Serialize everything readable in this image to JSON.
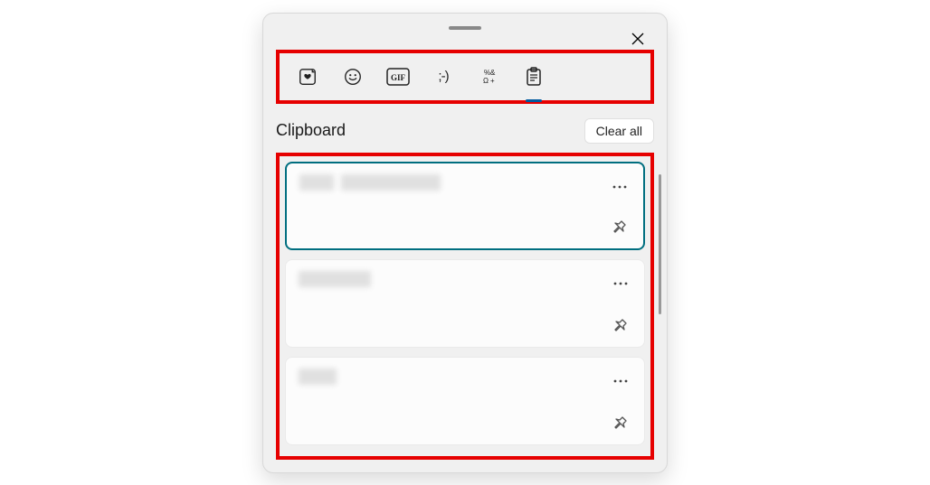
{
  "header": {
    "section_title": "Clipboard",
    "clear_all_label": "Clear all"
  },
  "toolbar": {
    "tabs": [
      {
        "name": "recent",
        "icon": "heart-sticker-icon"
      },
      {
        "name": "emoji",
        "icon": "smiley-icon"
      },
      {
        "name": "gif",
        "icon": "gif-icon"
      },
      {
        "name": "kaomoji",
        "icon": "kaomoji-icon",
        "label": ";-)"
      },
      {
        "name": "symbols",
        "icon": "symbols-icon"
      },
      {
        "name": "clipboard",
        "icon": "clipboard-icon",
        "active": true
      }
    ]
  },
  "clipboard_items": [
    {
      "selected": true,
      "blur_widths": [
        38,
        110
      ]
    },
    {
      "selected": false,
      "blur_widths": [
        80
      ]
    },
    {
      "selected": false,
      "blur_widths": [
        42
      ]
    }
  ]
}
